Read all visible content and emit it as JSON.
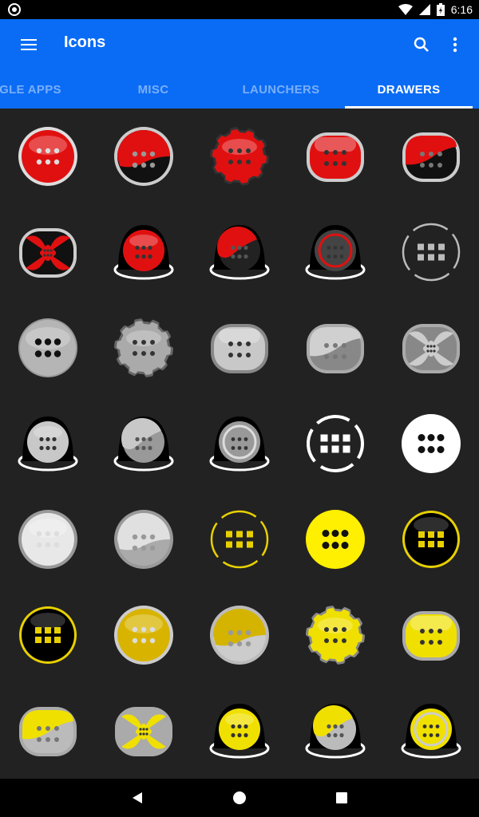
{
  "status_bar": {
    "time": "6:16"
  },
  "app_bar": {
    "title": "Icons",
    "color": "#0a6cf5"
  },
  "tabs": [
    {
      "label": "OGLE APPS",
      "active": false
    },
    {
      "label": "MISC",
      "active": false
    },
    {
      "label": "LAUNCHERS",
      "active": false
    },
    {
      "label": "DRAWERS",
      "active": true
    }
  ],
  "icons": [
    {
      "name": "drawer-red-glossy-icon",
      "style": "dots6",
      "bg": "#e01010",
      "ring": "#ddd"
    },
    {
      "name": "drawer-red-black-split-icon",
      "style": "split6",
      "bg": "#e01010",
      "bg2": "#111",
      "ring": "#ccc"
    },
    {
      "name": "drawer-red-gear-icon",
      "style": "gear8",
      "bg": "#e01010",
      "ring": "#333"
    },
    {
      "name": "drawer-red-rounded-icon",
      "style": "rrect6",
      "bg": "#e01010",
      "ring": "#ccc"
    },
    {
      "name": "drawer-red-black-wave-icon",
      "style": "rsplit6",
      "bg": "#e01010",
      "bg2": "#111",
      "ring": "#ccc"
    },
    {
      "name": "drawer-red-fan-icon",
      "style": "fan",
      "bg": "#e01010",
      "bg2": "#111",
      "ring": "#ccc"
    },
    {
      "name": "drawer-red-dome-icon",
      "style": "dome6",
      "bg": "#e01010",
      "ring": "#fff"
    },
    {
      "name": "drawer-red-dome-split-icon",
      "style": "domesplit6",
      "bg": "#e01010",
      "bg2": "#222",
      "ring": "#fff"
    },
    {
      "name": "drawer-red-dome-ring-icon",
      "style": "domering",
      "bg": "#444",
      "bg2": "#e01010",
      "ring": "#fff"
    },
    {
      "name": "drawer-grey-squares-icon",
      "style": "squares",
      "bg": "#333",
      "bg2": "#bbb",
      "ring": "#bbb"
    },
    {
      "name": "drawer-silver-brushed-icon",
      "style": "dots6big",
      "bg": "#b5b5b5",
      "ring": "#999"
    },
    {
      "name": "drawer-silver-gear-icon",
      "style": "gear8",
      "bg": "#aaa",
      "ring": "#666"
    },
    {
      "name": "drawer-silver-rounded-icon",
      "style": "rrect6",
      "bg": "#c8c8c8",
      "ring": "#888"
    },
    {
      "name": "drawer-silver-wave-icon",
      "style": "rsplit6",
      "bg": "#d0d0d0",
      "bg2": "#888",
      "ring": "#aaa"
    },
    {
      "name": "drawer-silver-fan-icon",
      "style": "fan",
      "bg": "#ccc",
      "bg2": "#888",
      "ring": "#aaa"
    },
    {
      "name": "drawer-silver-dome-icon",
      "style": "dome6",
      "bg": "#c8c8c8",
      "ring": "#fff"
    },
    {
      "name": "drawer-silver-dome-split-icon",
      "style": "domesplit6",
      "bg": "#c8c8c8",
      "bg2": "#999",
      "ring": "#fff"
    },
    {
      "name": "drawer-silver-dome-ring-icon",
      "style": "domering",
      "bg": "#999",
      "bg2": "#ddd",
      "ring": "#fff"
    },
    {
      "name": "drawer-white-ring-squares-icon",
      "style": "ringsquares",
      "bg": "#222",
      "bg2": "#fff",
      "ring": "#fff"
    },
    {
      "name": "drawer-white-flat-icon",
      "style": "flat6",
      "bg": "#ffffff",
      "bg2": "#111",
      "ring": "#fff"
    },
    {
      "name": "drawer-white-glossy-icon",
      "style": "dots6",
      "bg": "#e8e8e8",
      "ring": "#999"
    },
    {
      "name": "drawer-white-wave-icon",
      "style": "split6",
      "bg": "#e0e0e0",
      "bg2": "#aaa",
      "ring": "#999"
    },
    {
      "name": "drawer-yellow-ring-squares-icon",
      "style": "squares",
      "bg": "#222",
      "bg2": "#e8d000",
      "ring": "#e8d000"
    },
    {
      "name": "drawer-yellow-flat-icon",
      "style": "flat6",
      "bg": "#ffef00",
      "bg2": "#111",
      "ring": "#ffef00"
    },
    {
      "name": "drawer-yellow-black-ring-icon",
      "style": "squaresfill",
      "bg": "#000",
      "bg2": "#e8d000",
      "ring": "#e8d000"
    },
    {
      "name": "drawer-black-yellow-ring-icon",
      "style": "squaresfill",
      "bg": "#000",
      "bg2": "#e8d000",
      "ring": "#e8d000"
    },
    {
      "name": "drawer-gold-glossy-icon",
      "style": "dots6",
      "bg": "#d8b400",
      "ring": "#ccc"
    },
    {
      "name": "drawer-gold-silver-split-icon",
      "style": "split6",
      "bg": "#d4b400",
      "bg2": "#ccc",
      "ring": "#bbb"
    },
    {
      "name": "drawer-yellow-gear-icon",
      "style": "gear8",
      "bg": "#f0e000",
      "ring": "#888"
    },
    {
      "name": "drawer-yellow-rounded-icon",
      "style": "rrect6",
      "bg": "#f0e000",
      "ring": "#aaa"
    },
    {
      "name": "drawer-yellow-wave-icon",
      "style": "rsplit6",
      "bg": "#f0e000",
      "bg2": "#bbb",
      "ring": "#aaa"
    },
    {
      "name": "drawer-yellow-fan-icon",
      "style": "fan",
      "bg": "#f0e000",
      "bg2": "#aaa",
      "ring": "#aaa"
    },
    {
      "name": "drawer-yellow-dome-icon",
      "style": "dome6",
      "bg": "#f0e000",
      "ring": "#fff"
    },
    {
      "name": "drawer-yellow-dome-split-icon",
      "style": "domesplit6",
      "bg": "#f0e000",
      "bg2": "#bbb",
      "ring": "#fff"
    },
    {
      "name": "drawer-yellow-dome-ring-icon",
      "style": "domering",
      "bg": "#f0e000",
      "bg2": "#ccc",
      "ring": "#fff"
    }
  ]
}
